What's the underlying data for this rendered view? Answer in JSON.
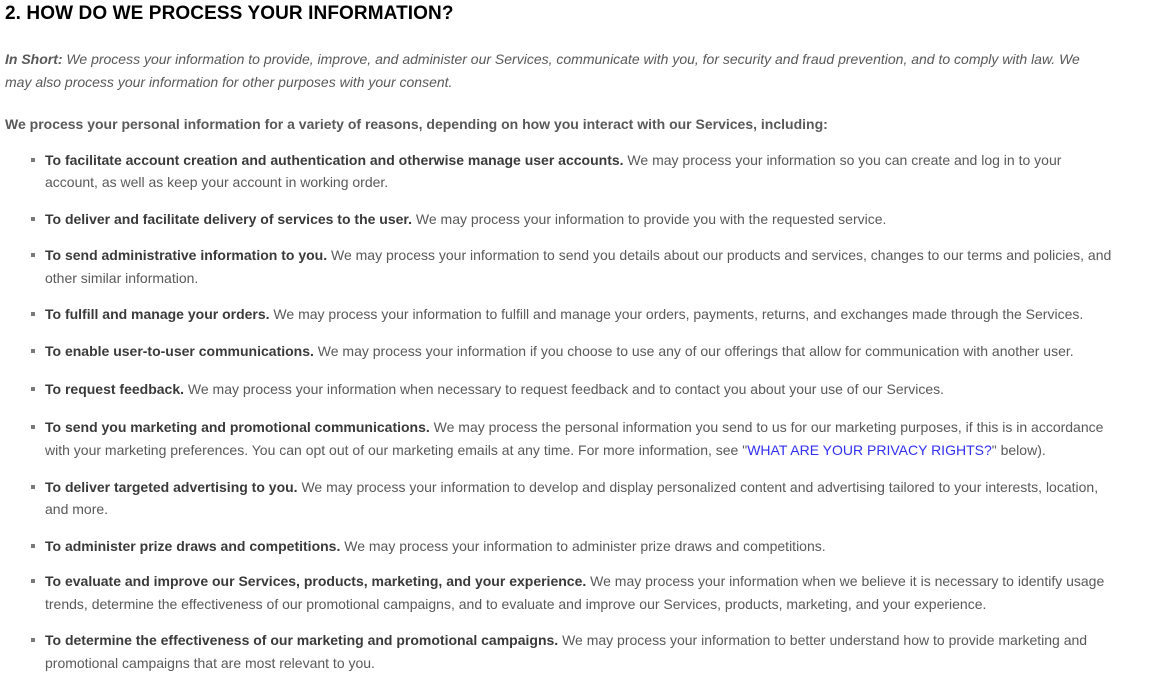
{
  "section": {
    "title": "2. HOW DO WE PROCESS YOUR INFORMATION?",
    "in_short_label": "In Short:",
    "in_short_text": " We process your information to provide, improve, and administer our Services, communicate with you, for security and fraud prevention, and to comply with law. We may also process your information for other purposes with your consent.",
    "intro": "We process your personal information for a variety of reasons, depending on how you interact with our Services, including:"
  },
  "purposes": [
    {
      "title": "To facilitate account creation and authentication and otherwise manage user accounts.",
      "text": " We may process your information so you can create and log in to your account, as well as keep your account in working order."
    },
    {
      "title": "To deliver and facilitate delivery of services to the user.",
      "text": " We may process your information to provide you with the requested service."
    },
    {
      "title": "To send administrative information to you.",
      "text": " We may process your information to send you details about our products and services, changes to our terms and policies, and other similar information."
    },
    {
      "title": "To fulfill and manage your orders.",
      "text": " We may process your information to fulfill and manage your orders, payments, returns, and exchanges made through the Services."
    },
    {
      "title": "To enable user-to-user communications.",
      "text": " We may process your information if you choose to use any of our offerings that allow for communication with another user."
    },
    {
      "title": "To request feedback.",
      "text": " We may process your information when necessary to request feedback and to contact you about your use of our Services."
    },
    {
      "title": "To send you marketing and promotional communications.",
      "text": " We may process the personal information you send to us for our marketing purposes, if this is in accordance with your marketing preferences. You can opt out of our marketing emails at any time. For more information, see \"",
      "link": "WHAT ARE YOUR PRIVACY RIGHTS?",
      "text_after": "\" below)."
    },
    {
      "title": "To deliver targeted advertising to you.",
      "text": " We may process your information to develop and display personalized content and advertising tailored to your interests, location, and more."
    },
    {
      "title": "To administer prize draws and competitions.",
      "text": " We may process your information to administer prize draws and competitions."
    },
    {
      "title": "To evaluate and improve our Services, products, marketing, and your experience.",
      "text": " We may process your information when we believe it is necessary to identify usage trends, determine the effectiveness of our promotional campaigns, and to evaluate and improve our Services, products, marketing, and your experience."
    },
    {
      "title": "To determine the effectiveness of our marketing and promotional campaigns.",
      "text": " We may process your information to better understand how to provide marketing and promotional campaigns that are most relevant to you."
    }
  ]
}
